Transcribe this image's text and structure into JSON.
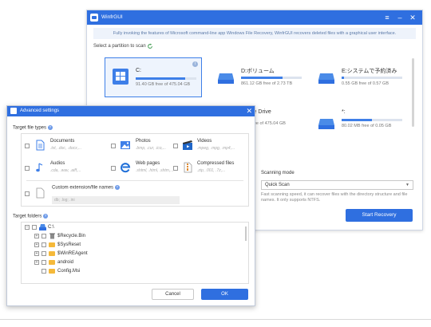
{
  "main_window": {
    "title": "WinfrGUI",
    "info_banner": "Fully invoking the features of Microsoft command-line app Windows File Recovery, WinfrGUI recovers deleted files with a graphical user interface.",
    "partition_label": "Select a partition to scan",
    "partitions": [
      {
        "name": "C:",
        "free": "91.40 GB free of 475.04 GB",
        "used_fraction": 0.81,
        "selected": true
      },
      {
        "name": "D:ボリューム",
        "free": "861.12 GB free of 2.73 TB",
        "used_fraction": 0.69,
        "selected": false
      },
      {
        "name": "E:システムで予約済み",
        "free": "0.55 GB free of 0.57 GB",
        "used_fraction": 0.04,
        "selected": false
      },
      {
        "name": "le Drive",
        "free": "ree of 475.04 GB",
        "used_fraction": 0.8,
        "selected": false
      },
      {
        "name": "*:",
        "free": "80.02 MB free of 0.05 GB",
        "used_fraction": 0.5,
        "selected": false
      }
    ],
    "scanning_mode_label": "Scanning mode",
    "scan_mode_value": "Quick Scan",
    "scan_desc": "Fast scanning speed, it can recover files with the directory structure and file names. It only supports NTFS.",
    "start_button": "Start Recovery",
    "colors": {
      "accent": "#2f6fe0",
      "banner_bg": "#eef3fb"
    }
  },
  "advanced": {
    "title": "Advanced settings",
    "file_types_label": "Target file types",
    "file_types": [
      {
        "name": "Documents",
        "ext": ".txt, .doc, .docx,...",
        "icon": "document-icon"
      },
      {
        "name": "Photos",
        "ext": ".bmp, .cur, .ico,...",
        "icon": "photo-icon"
      },
      {
        "name": "Videos",
        "ext": ".mpeg, .mpg, .mp4,...",
        "icon": "video-icon"
      },
      {
        "name": "Audios",
        "ext": ".cda, .wav, .aiff,...",
        "icon": "audio-icon"
      },
      {
        "name": "Web pages",
        "ext": ".shtml, .html, .shtm,...",
        "icon": "web-page-icon"
      },
      {
        "name": "Compressed files",
        "ext": ".zip, .001, .7z,...",
        "icon": "compressed-icon"
      }
    ],
    "custom_label": "Custom extension/file names",
    "custom_placeholder": "db; .log; .ini",
    "folders_label": "Target folders",
    "tree": [
      {
        "label": "C:\\",
        "level": 0,
        "icon": "drive-icon"
      },
      {
        "label": "$Recycle.Bin",
        "level": 1,
        "icon": "recycle-icon"
      },
      {
        "label": "$SysReset",
        "level": 1,
        "icon": "folder-icon"
      },
      {
        "label": "$WinREAgent",
        "level": 1,
        "icon": "folder-icon"
      },
      {
        "label": "android",
        "level": 1,
        "icon": "folder-icon"
      },
      {
        "label": "Config.Msi",
        "level": 1,
        "icon": "folder-icon"
      }
    ],
    "cancel_button": "Cancel",
    "ok_button": "OK"
  }
}
